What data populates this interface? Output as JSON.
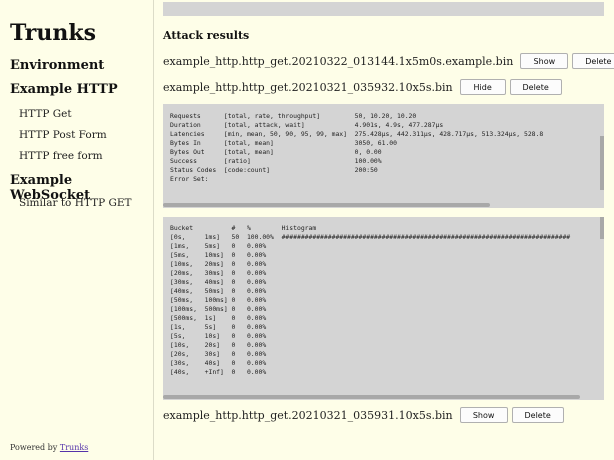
{
  "sidebar": {
    "title": "Trunks",
    "sections": [
      {
        "heading": "Environment",
        "items": []
      },
      {
        "heading": "Example HTTP",
        "items": [
          "HTTP Get",
          "HTTP Post Form",
          "HTTP free form"
        ]
      },
      {
        "heading": "Example WebSocket",
        "items": [
          "Similar to HTTP GET"
        ]
      }
    ],
    "footer": {
      "prefix": "Powered by ",
      "link": "Trunks"
    }
  },
  "main": {
    "heading": "Attack results",
    "results": [
      {
        "name": "example_http.http_get.20210322_013144.1x5m0s.example.bin",
        "toggle_label": "Show",
        "delete_label": "Delete"
      },
      {
        "name": "example_http.http_get.20210321_035932.10x5s.bin",
        "toggle_label": "Hide",
        "delete_label": "Delete"
      },
      {
        "name": "example_http.http_get.20210321_035931.10x5s.bin",
        "toggle_label": "Show",
        "delete_label": "Delete"
      }
    ],
    "summary_text": "Requests      [total, rate, throughput]         50, 10.20, 10.20\nDuration      [total, attack, wait]             4.901s, 4.9s, 477.287µs\nLatencies     [min, mean, 50, 90, 95, 99, max]  275.428µs, 442.311µs, 428.717µs, 513.324µs, 528.8\nBytes In      [total, mean]                     3050, 61.00\nBytes Out     [total, mean]                     0, 0.00\nSuccess       [ratio]                           100.00%\nStatus Codes  [code:count]                      200:50\nError Set:",
    "histogram_text": "Bucket          #   %        Histogram\n[0s,     1ms]   50  100.00%  ###########################################################################\n[1ms,    5ms]   0   0.00%\n[5ms,    10ms]  0   0.00%\n[10ms,   20ms]  0   0.00%\n[20ms,   30ms]  0   0.00%\n[30ms,   40ms]  0   0.00%\n[40ms,   50ms]  0   0.00%\n[50ms,   100ms] 0   0.00%\n[100ms,  500ms] 0   0.00%\n[500ms,  1s]    0   0.00%\n[1s,     5s]    0   0.00%\n[5s,     10s]   0   0.00%\n[10s,    20s]   0   0.00%\n[20s,    30s]   0   0.00%\n[30s,    40s]   0   0.00%\n[40s,    +Inf]  0   0.00%"
  }
}
